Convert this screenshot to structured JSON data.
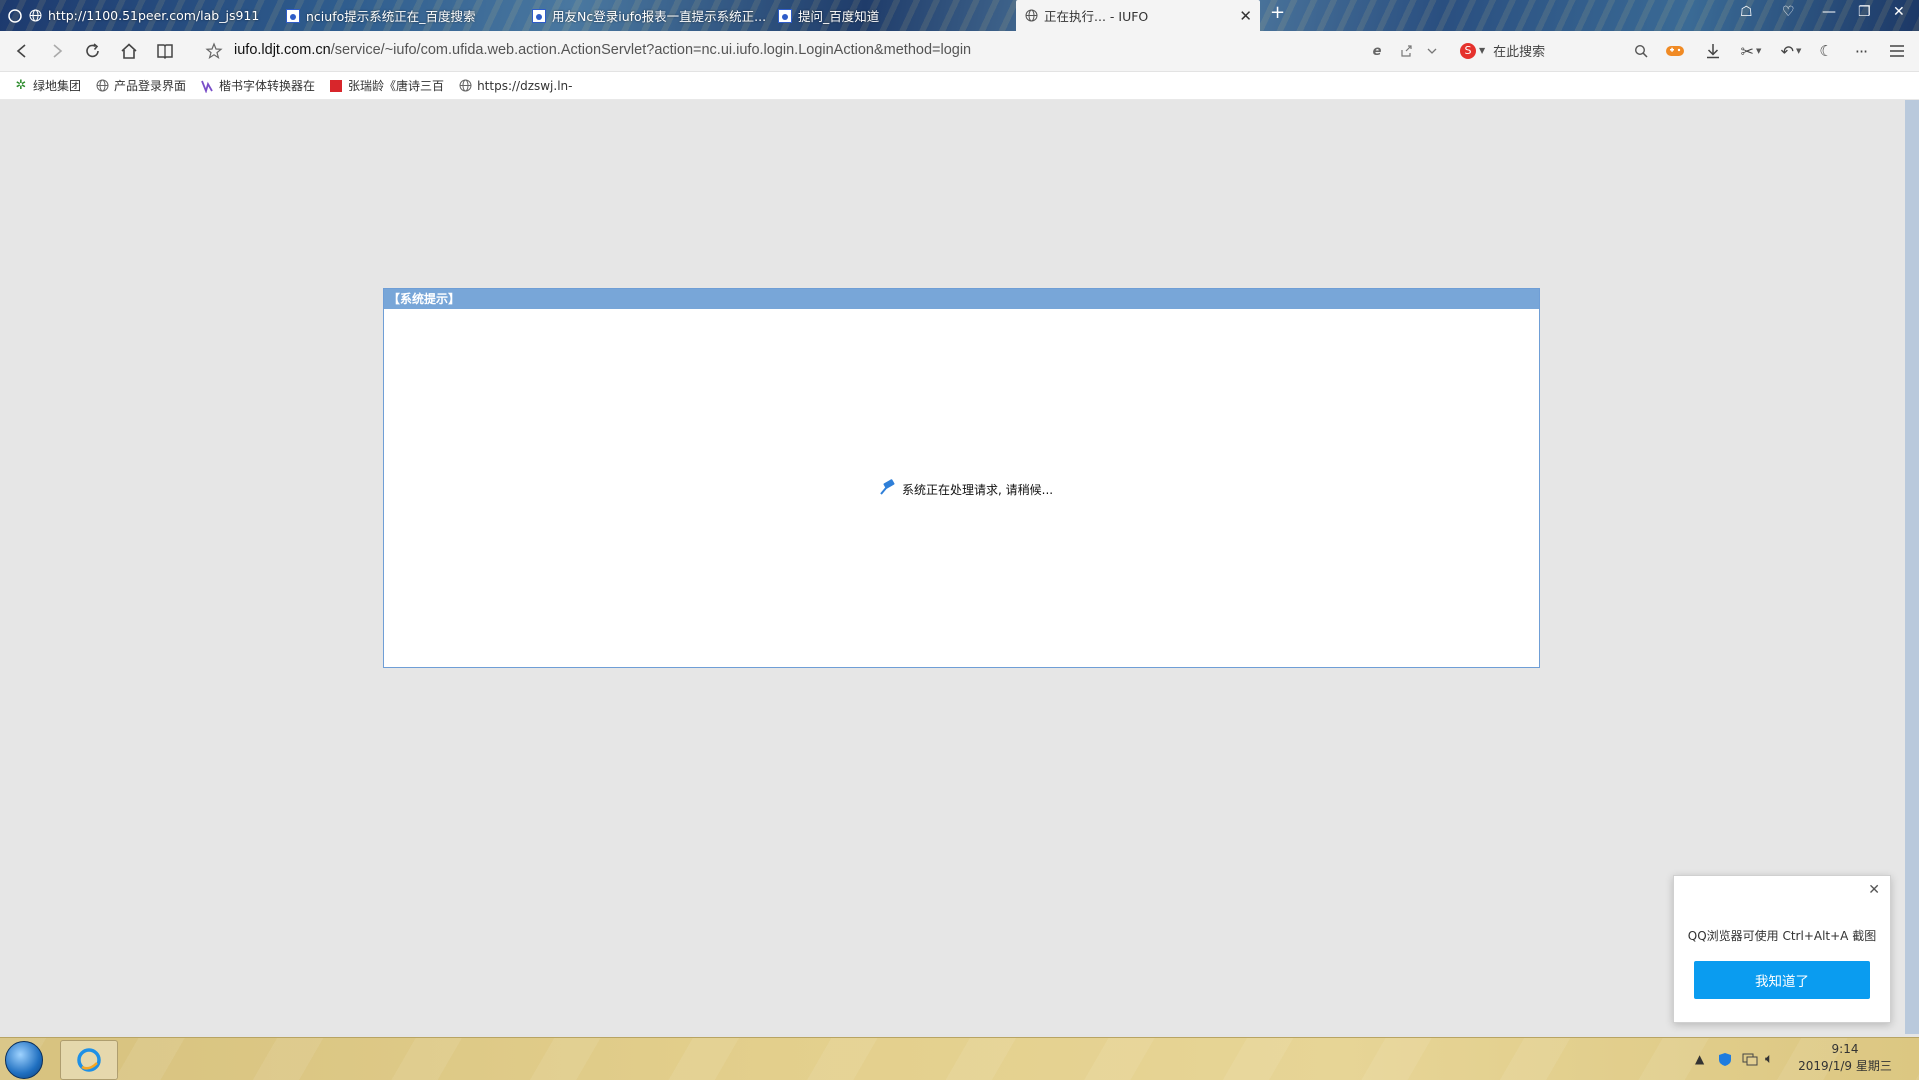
{
  "tabs": [
    {
      "label": "http://1100.51peer.com/lab_js911",
      "active": false
    },
    {
      "label": "nciufo提示系统正在_百度搜索",
      "active": false
    },
    {
      "label": "用友Nc登录iufo报表一直提示系统正...",
      "active": false
    },
    {
      "label": "提问_百度知道",
      "active": false
    },
    {
      "label": "正在执行... - IUFO",
      "active": true
    }
  ],
  "toolbar": {
    "url_host": "iufo.ldjt.com.cn",
    "url_path": "/service/~iufo/com.ufida.web.action.ActionServlet?action=nc.ui.iufo.login.LoginAction&method=login",
    "search_placeholder": "在此搜索"
  },
  "bookmarks": [
    {
      "label": "绿地集团",
      "icon": "snowflake-icon"
    },
    {
      "label": "产品登录界面",
      "icon": "globe-icon"
    },
    {
      "label": "楷书字体转换器在",
      "icon": "brand-icon"
    },
    {
      "label": "张瑞龄《唐诗三百",
      "icon": "red-book-icon"
    },
    {
      "label": "https://dzswj.ln-",
      "icon": "globe-icon"
    }
  ],
  "dialog": {
    "title": "【系统提示】",
    "message": "系统正在处理请求, 请稍候..."
  },
  "popup": {
    "text": "QQ浏览器可使用 Ctrl+Alt+A 截图",
    "button_label": "我知道了"
  },
  "taskbar": {
    "time": "9:14",
    "date": "2019/1/9 星期三"
  },
  "colors": {
    "dialog_border": "#6f9ed6",
    "dialog_title_bg": "#78a6d8",
    "popup_button": "#0a9cf0",
    "content_bg": "#e6e6e6"
  }
}
